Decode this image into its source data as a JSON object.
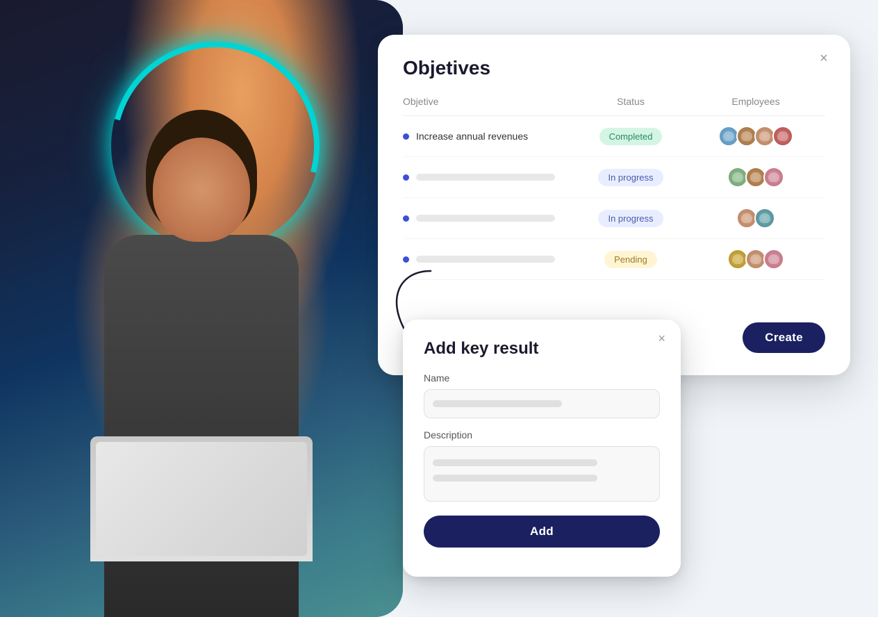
{
  "background": {
    "alt": "Woman working on laptop in modern office"
  },
  "objectives_panel": {
    "title": "Objetives",
    "close_icon": "×",
    "columns": {
      "objective": "Objetive",
      "status": "Status",
      "employees": "Employees"
    },
    "rows": [
      {
        "id": 1,
        "objective_text": "Increase annual revenues",
        "objective_is_text": true,
        "status": "Completed",
        "status_type": "completed",
        "employees": [
          "blue",
          "brown",
          "tan",
          "red"
        ]
      },
      {
        "id": 2,
        "objective_text": "",
        "objective_is_text": false,
        "status": "In progress",
        "status_type": "inprogress",
        "employees": [
          "green",
          "brown",
          "pink"
        ]
      },
      {
        "id": 3,
        "objective_text": "",
        "objective_is_text": false,
        "status": "In progress",
        "status_type": "inprogress",
        "employees": [
          "tan",
          "teal"
        ]
      },
      {
        "id": 4,
        "objective_text": "",
        "objective_is_text": false,
        "status": "Pending",
        "status_type": "pending",
        "employees": [
          "gold",
          "tan",
          "pink"
        ]
      }
    ],
    "create_button": "Create"
  },
  "add_key_result_panel": {
    "title": "Add key result",
    "close_icon": "×",
    "name_label": "Name",
    "name_placeholder": "",
    "description_label": "Description",
    "description_placeholder": "",
    "add_button": "Add"
  }
}
